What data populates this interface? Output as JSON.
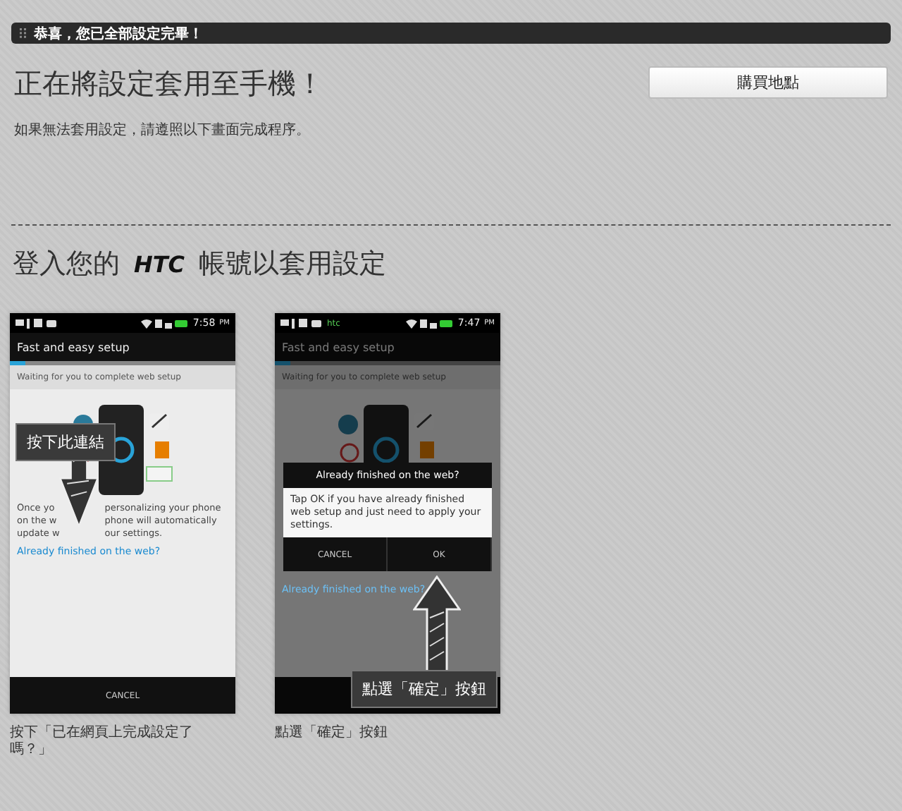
{
  "banner": {
    "title": "恭喜，您已全部設定完畢！"
  },
  "heading": "正在將設定套用至手機！",
  "buy_button": "購買地點",
  "instructions": "如果無法套用設定，請遵照以下畫面完成程序。",
  "section_title": {
    "before": "登入您的",
    "brand": "HTC",
    "after": "帳號以套用設定"
  },
  "steps": [
    {
      "kind": "link",
      "status": {
        "time": "7:58",
        "ampm": "PM"
      },
      "app_title": "Fast and easy setup",
      "level": 0.07,
      "waiting": "Waiting for you to complete web setup",
      "body_lines": [
        [
          "Once yo",
          "personalizing your phone"
        ],
        [
          "on the w",
          "phone will automatically"
        ],
        [
          "update w",
          "our settings."
        ]
      ],
      "link": "Already finished on the web?",
      "bottom_button": "CANCEL",
      "callout": "按下此連結",
      "caption": "按下「已在網頁上完成設定了嗎？」"
    },
    {
      "kind": "dialog",
      "status": {
        "carrier": "htc",
        "time": "7:47",
        "ampm": "PM"
      },
      "app_title": "Fast and easy setup",
      "level": 0.07,
      "waiting": "Waiting for you to complete web setup",
      "link": "Already finished on the web?",
      "dialog": {
        "title": "Already finished on the web?",
        "message": "Tap OK if you have already finished web setup and just need to apply your settings.",
        "buttons": [
          "CANCEL",
          "OK"
        ]
      },
      "callout": "點選「確定」按鈕",
      "caption": "點選「確定」按鈕"
    }
  ]
}
